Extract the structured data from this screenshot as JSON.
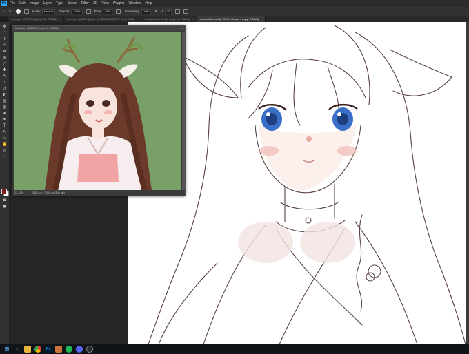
{
  "menubar": {
    "logo": "Ps",
    "items": [
      "File",
      "Edit",
      "Image",
      "Layer",
      "Type",
      "Select",
      "Filter",
      "3D",
      "View",
      "Plugins",
      "Window",
      "Help"
    ]
  },
  "options": {
    "mode_label": "Mode:",
    "mode_value": "Normal",
    "opacity_label": "Opacity:",
    "opacity_value": "100%",
    "flow_label": "Flow:",
    "flow_value": "50%",
    "smoothing_label": "Smoothing:",
    "smoothing_value": "10%",
    "angle_value": "0°"
  },
  "tabs": [
    {
      "label": "deer.psd @ 73.1% (Layer 16, RGB/8)",
      "active": false
    },
    {
      "label": "deer.psd @ 10% (Layer 16, RGB/8#/CMYK (Gen 2014)",
      "active": false
    },
    {
      "label": "Untitled-1 @ 39.6% (Layer 1, RGB/8)",
      "active": false
    },
    {
      "label": "dear shiller.psd @ 22.7% (Layer 4 copy, RGB/8)",
      "active": true
    }
  ],
  "reference_window": {
    "title": "Untitled-1 @ 53.9% (Layer 0, RGB/8)",
    "zoom": "22.43%",
    "doc_size": "3000 px x 3000 px (300 ppi)"
  },
  "colors": {
    "foreground": "#7a1d1d",
    "background": "#ffffff",
    "ref_bg": "#7aa06a",
    "accent": "#31a8ff"
  },
  "taskbar": {
    "icons": [
      "windows-icon",
      "search-icon",
      "file-explorer-icon",
      "chrome-icon",
      "photoshop-icon",
      "clip-studio-icon",
      "spotify-icon",
      "discord-icon",
      "obs-icon"
    ]
  }
}
